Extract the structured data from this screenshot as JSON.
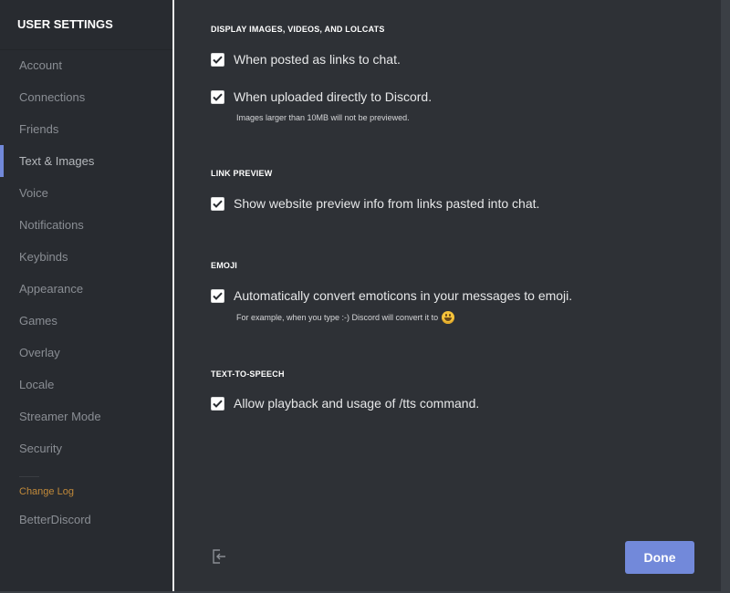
{
  "sidebar": {
    "title": "USER SETTINGS",
    "items": [
      {
        "label": "Account"
      },
      {
        "label": "Connections"
      },
      {
        "label": "Friends"
      },
      {
        "label": "Text & Images"
      },
      {
        "label": "Voice"
      },
      {
        "label": "Notifications"
      },
      {
        "label": "Keybinds"
      },
      {
        "label": "Appearance"
      },
      {
        "label": "Games"
      },
      {
        "label": "Overlay"
      },
      {
        "label": "Locale"
      },
      {
        "label": "Streamer Mode"
      },
      {
        "label": "Security"
      }
    ],
    "active_item": "Text & Images",
    "changelog": "Change Log",
    "betterdiscord": "BetterDiscord"
  },
  "sections": {
    "display": {
      "title": "DISPLAY IMAGES, VIDEOS, AND LOLCATS",
      "links_label": "When posted as links to chat.",
      "links_checked": true,
      "uploads_label": "When uploaded directly to Discord.",
      "uploads_checked": true,
      "uploads_note": "Images larger than 10MB will not be previewed."
    },
    "link_preview": {
      "title": "LINK PREVIEW",
      "label": "Show website preview info from links pasted into chat.",
      "checked": true
    },
    "emoji": {
      "title": "EMOJI",
      "label": "Automatically convert emoticons in your messages to emoji.",
      "checked": true,
      "note": "For example, when you type :-) Discord will convert it to"
    },
    "tts": {
      "title": "TEXT-TO-SPEECH",
      "label": "Allow playback and usage of /tts command.",
      "checked": true
    }
  },
  "footer": {
    "done_label": "Done",
    "logout_icon": "logout-icon"
  },
  "colors": {
    "accent": "#7289da",
    "changelog": "#c28a3a",
    "sidebar_bg": "#282b30",
    "content_bg": "#2e3136"
  }
}
